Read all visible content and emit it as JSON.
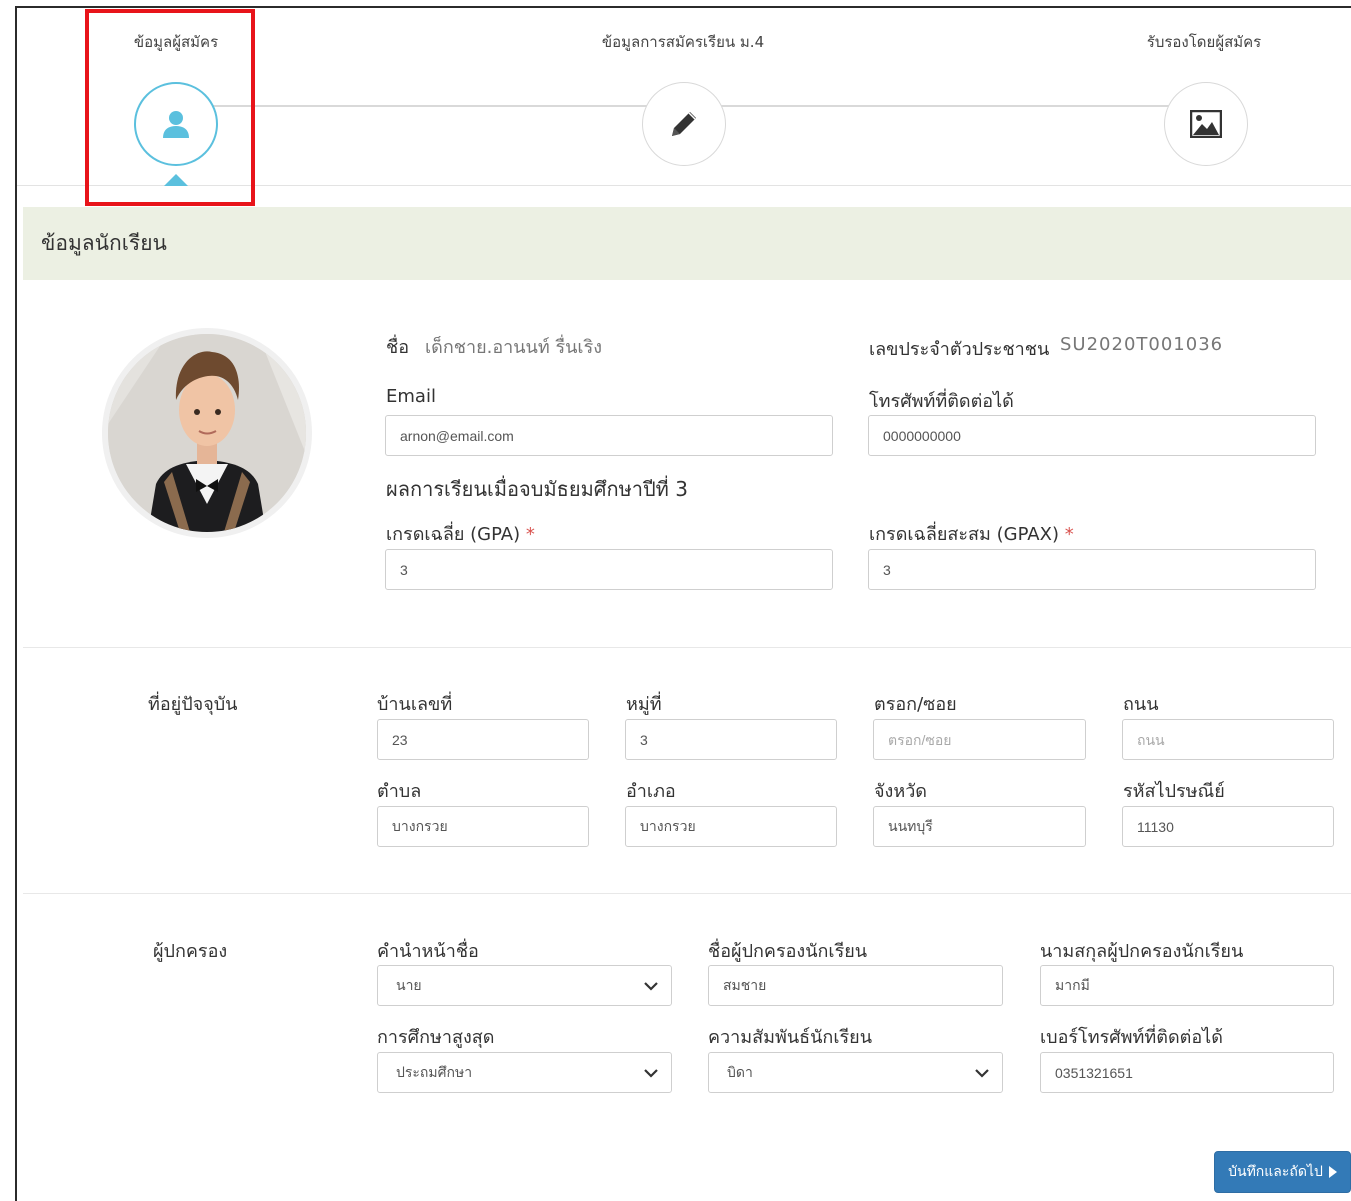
{
  "steps": [
    {
      "label": "ข้อมูลผู้สมัคร",
      "icon": "user-icon",
      "active": true
    },
    {
      "label": "ข้อมูลการสมัครเรียน ม.4",
      "icon": "pencil-icon",
      "active": false
    },
    {
      "label": "รับรองโดยผู้สมัคร",
      "icon": "image-icon",
      "active": false
    }
  ],
  "section": {
    "title": "ข้อมูลนักเรียน"
  },
  "student": {
    "name_label": "ชื่อ",
    "name_value": "เด็กชาย.อานนท์ รื่นเริง",
    "id_label": "เลขประจำตัวประชาชน",
    "id_value": "SU2020T001036",
    "email_label": "Email",
    "email_value": "arnon@email.com",
    "phone_label": "โทรศัพท์ที่ติดต่อได้",
    "phone_value": "0000000000",
    "results_heading": "ผลการเรียนเมื่อจบมัธยมศึกษาปีที่ 3",
    "gpa_label": "เกรดเฉลี่ย (GPA)",
    "gpa_value": "3",
    "gpax_label": "เกรดเฉลี่ยสะสม (GPAX)",
    "gpax_value": "3",
    "required_mark": "*"
  },
  "address": {
    "section_label": "ที่อยู่ปัจจุบัน",
    "house_no_label": "บ้านเลขที่",
    "house_no_value": "23",
    "moo_label": "หมู่ที่",
    "moo_value": "3",
    "soi_label": "ตรอก/ซอย",
    "soi_placeholder": "ตรอก/ซอย",
    "road_label": "ถนน",
    "road_placeholder": "ถนน",
    "subdistrict_label": "ตำบล",
    "subdistrict_value": "บางกรวย",
    "district_label": "อำเภอ",
    "district_value": "บางกรวย",
    "province_label": "จังหวัด",
    "province_value": "นนทบุรี",
    "postcode_label": "รหัสไปรษณีย์",
    "postcode_value": "11130"
  },
  "guardian": {
    "section_label": "ผู้ปกครอง",
    "prefix_label": "คำนำหน้าชื่อ",
    "prefix_value": "นาย",
    "first_name_label": "ชื่อผู้ปกครองนักเรียน",
    "first_name_value": "สมชาย",
    "last_name_label": "นามสกุลผู้ปกครองนักเรียน",
    "last_name_value": "มากมี",
    "education_label": "การศึกษาสูงสุด",
    "education_value": "ประถมศึกษา",
    "relation_label": "ความสัมพันธ์นักเรียน",
    "relation_value": "บิดา",
    "phone_label": "เบอร์โทรศัพท์ที่ติดต่อได้",
    "phone_value": "0351321651"
  },
  "actions": {
    "next_label": "บันทึกและถัดไป"
  },
  "colors": {
    "accent": "#5bc0de",
    "primary": "#337ab7",
    "highlight": "#e8141a",
    "section_bg": "#ecf0e3"
  }
}
